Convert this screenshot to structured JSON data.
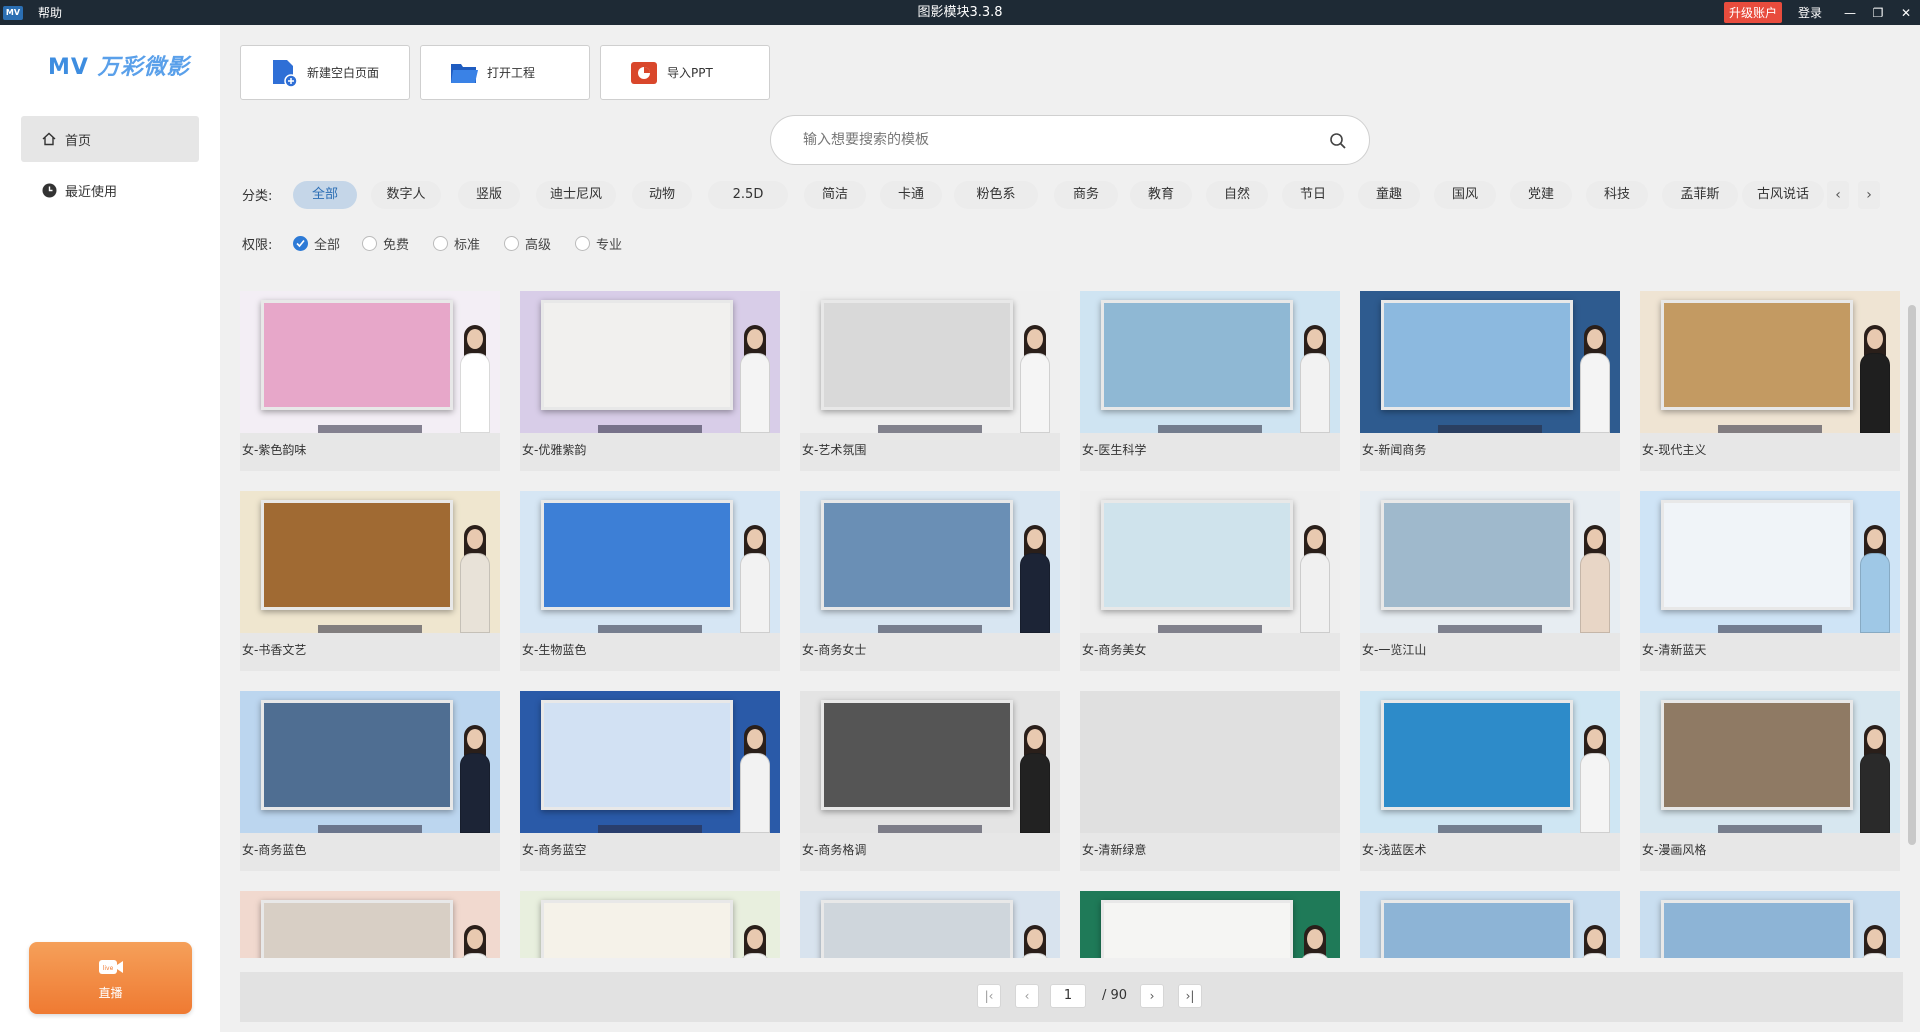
{
  "titlebar": {
    "logo": "MV",
    "help_menu": "帮助",
    "window_title": "图影模块3.3.8",
    "upgrade_label": "升级账户",
    "login_label": "登录",
    "min_icon": "—",
    "restore_icon": "❐",
    "close_icon": "✕"
  },
  "sidebar": {
    "brand_latin": "MV",
    "brand_cn": "万彩微影",
    "items": [
      {
        "label": "首页",
        "icon": "home-icon",
        "active": true
      },
      {
        "label": "最近使用",
        "icon": "clock-icon",
        "active": false
      }
    ],
    "live_label": "直播",
    "live_badge": "live"
  },
  "quick_actions": [
    {
      "label": "新建空白页面",
      "icon": "new-page-icon",
      "color": "#2f6fd6"
    },
    {
      "label": "打开工程",
      "icon": "folder-icon",
      "color": "#2f6fd6"
    },
    {
      "label": "导入PPT",
      "icon": "ppt-icon",
      "color": "#d9472b"
    }
  ],
  "search": {
    "placeholder": "输入想要搜索的模板",
    "value": ""
  },
  "category": {
    "label": "分类:",
    "chips": [
      "全部",
      "数字人",
      "竖版",
      "迪士尼风",
      "动物",
      "2.5D",
      "简洁",
      "卡通",
      "粉色系",
      "商务",
      "教育",
      "自然",
      "节日",
      "童趣",
      "国风",
      "党建",
      "科技",
      "孟菲斯",
      "古风说话"
    ],
    "selected": "全部",
    "prev_icon": "‹",
    "next_icon": "›"
  },
  "permission": {
    "label": "权限:",
    "options": [
      "全部",
      "免费",
      "标准",
      "高级",
      "专业"
    ],
    "selected": "全部"
  },
  "templates": [
    {
      "title": "女-紫色韵味",
      "bg": "#f3eef5",
      "accent": "#e7a7c9",
      "body": "#ffffff"
    },
    {
      "title": "女-优雅紫韵",
      "bg": "#d8cde8",
      "accent": "#f1f0ee",
      "body": "#f4f4f4"
    },
    {
      "title": "女-艺术氛围",
      "bg": "#efefef",
      "accent": "#d9d9d9",
      "body": "#f5f5f5"
    },
    {
      "title": "女-医生科学",
      "bg": "#cfe4f2",
      "accent": "#8fb8d4",
      "body": "#f2f2f2"
    },
    {
      "title": "女-新闻商务",
      "bg": "#2e5b8f",
      "accent": "#8cb9df",
      "body": "#f4f4f4"
    },
    {
      "title": "女-现代主义",
      "bg": "#efe4d3",
      "accent": "#c39a62",
      "body": "#1f1f1f"
    },
    {
      "title": "女-书香文艺",
      "bg": "#efe6cf",
      "accent": "#a06a33",
      "body": "#e8e2d8"
    },
    {
      "title": "女-生物蓝色",
      "bg": "#d6e6f4",
      "accent": "#3d7fd6",
      "body": "#f2f2f2"
    },
    {
      "title": "女-商务女士",
      "bg": "#d8e6f2",
      "accent": "#6a8fb5",
      "body": "#1c2436"
    },
    {
      "title": "女-商务美女",
      "bg": "#eeeeee",
      "accent": "#cfe3ec",
      "body": "#f0f0f0"
    },
    {
      "title": "女-一览江山",
      "bg": "#e7edf2",
      "accent": "#9fb9cc",
      "body": "#e8d6c6"
    },
    {
      "title": "女-清新蓝天",
      "bg": "#cfe4f6",
      "accent": "#f0f4f8",
      "body": "#9fc8e6"
    },
    {
      "title": "女-商务蓝色",
      "bg": "#bcd6ef",
      "accent": "#4f6e92",
      "body": "#1c2436"
    },
    {
      "title": "女-商务蓝空",
      "bg": "#2a5aa8",
      "accent": "#d2e1f3",
      "body": "#f2f2f2"
    },
    {
      "title": "女-商务格调",
      "bg": "#e4e4e4",
      "accent": "#555555",
      "body": "#222222"
    },
    {
      "title": "女-清新绿意",
      "bg": "#e0e0e0",
      "accent": "#e0e0e0",
      "body": "#e0e0e0"
    },
    {
      "title": "女-浅蓝医术",
      "bg": "#cfe6f3",
      "accent": "#2d8bc9",
      "body": "#f4f4f4"
    },
    {
      "title": "女-漫画风格",
      "bg": "#d7e7f0",
      "accent": "#8f7a64",
      "body": "#2a2a2a"
    },
    {
      "title": "",
      "bg": "#f1d9cf",
      "accent": "#d8cfc5",
      "body": "#f2f2f2"
    },
    {
      "title": "",
      "bg": "#e8efde",
      "accent": "#f5f2e9",
      "body": "#f2f2f2"
    },
    {
      "title": "",
      "bg": "#d8e3ee",
      "accent": "#cfd6dc",
      "body": "#f2f2f2"
    },
    {
      "title": "",
      "bg": "#1f7a58",
      "accent": "#f5f5f3",
      "body": "#f2f2f2"
    },
    {
      "title": "",
      "bg": "#c9def0",
      "accent": "#8db4d6",
      "body": "#f2f2f2"
    },
    {
      "title": "",
      "bg": "#c9def0",
      "accent": "#8db4d6",
      "body": "#f2f2f2"
    }
  ],
  "pagination": {
    "first_icon": "|‹",
    "prev_icon": "‹",
    "current_page": "1",
    "total": "/ 90",
    "next_icon": "›",
    "last_icon": "›|"
  }
}
